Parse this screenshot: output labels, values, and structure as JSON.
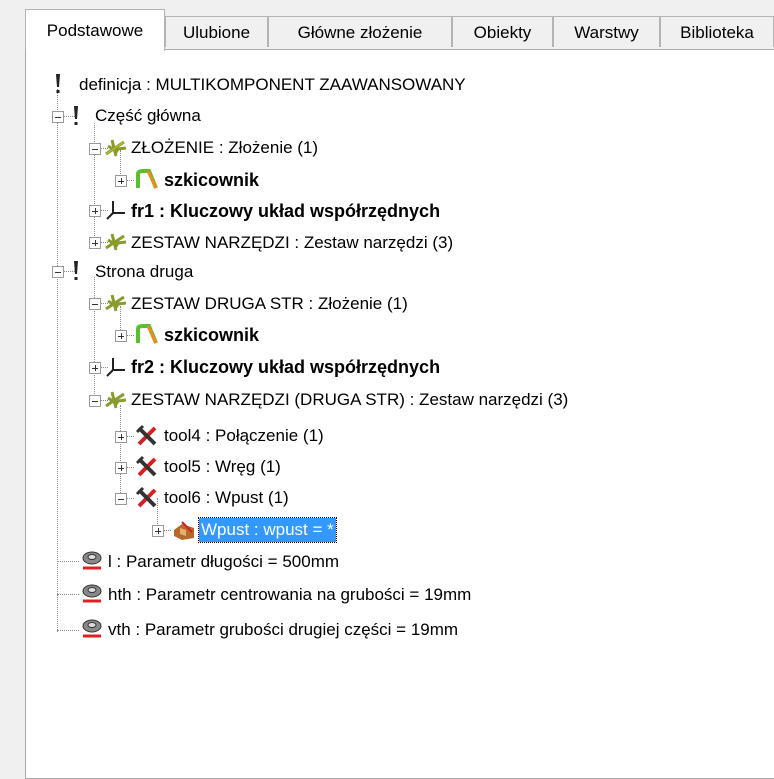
{
  "tabs": [
    {
      "label": "Podstawowe",
      "active": true
    },
    {
      "label": "Ulubione",
      "active": false
    },
    {
      "label": "Główne złożenie",
      "active": false
    },
    {
      "label": "Obiekty",
      "active": false
    },
    {
      "label": "Warstwy",
      "active": false
    },
    {
      "label": "Biblioteka",
      "active": false
    }
  ],
  "tree": {
    "root": "definicja : MULTIKOMPONENT ZAAWANSOWANY",
    "czesc_glowna": "Część główna",
    "zlozenie": "ZŁOŻENIE : Złożenie (1)",
    "szkicownik1": "szkicownik",
    "fr1": "fr1 : Kluczowy układ współrzędnych",
    "zestaw1": "ZESTAW NARZĘDZI : Zestaw narzędzi (3)",
    "strona_druga": "Strona druga",
    "zestaw_druga": "ZESTAW DRUGA STR : Złożenie (1)",
    "szkicownik2": "szkicownik",
    "fr2": "fr2 : Kluczowy układ współrzędnych",
    "zestaw2": "ZESTAW NARZĘDZI (DRUGA STR) : Zestaw narzędzi (3)",
    "tool4": "tool4 : Połączenie (1)",
    "tool5": "tool5 : Wręg (1)",
    "tool6": "tool6 : Wpust (1)",
    "wpust": "Wpust : wpust = *",
    "param_l": "l : Parametr długości = 500mm",
    "param_hth": "hth : Parametr centrowania na grubości = 19mm",
    "param_vth": "vth : Parametr grubości drugiej części = 19mm"
  },
  "icons": {
    "root": "exclamation-icon",
    "group": "exclamation-icon",
    "assembly": "assembly-icon",
    "sketch": "sketch-icon",
    "frame": "coordinate-frame-icon",
    "tool": "tool-icon",
    "feature": "feature-icon",
    "parameter": "parameter-icon"
  },
  "colors": {
    "selection": "#3399ff",
    "assembly_icon": "#8a9b2d",
    "sketch_icon_green": "#5abf2e",
    "sketch_icon_orange": "#f08a1a",
    "tool_icon_red": "#d42020",
    "parameter_icon_red": "#e02020"
  }
}
